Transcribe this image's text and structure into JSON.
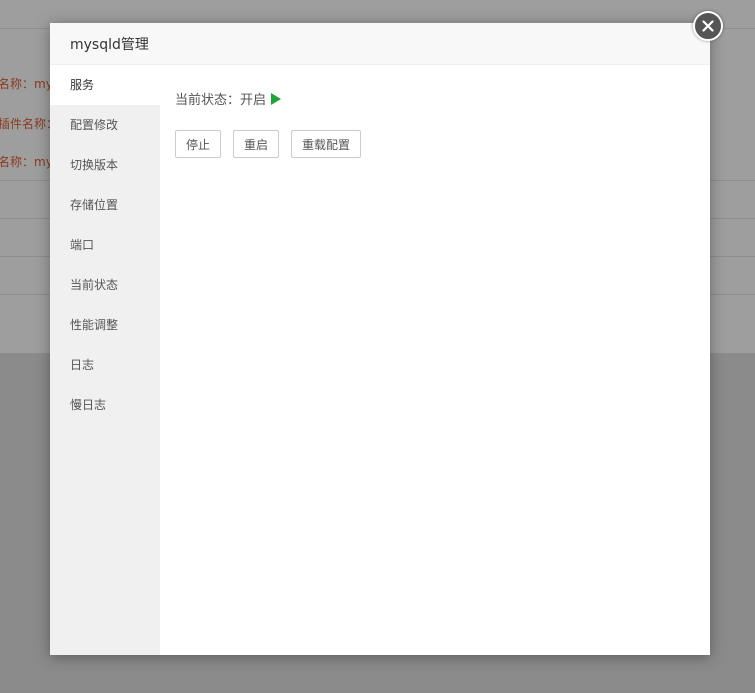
{
  "background": {
    "row_texts": [
      "名称：mys",
      "插件名称：",
      "名称：my"
    ]
  },
  "modal": {
    "title": "mysqld管理",
    "close_icon": "close-icon"
  },
  "sidebar": {
    "items": [
      {
        "label": "服务",
        "active": true
      },
      {
        "label": "配置修改"
      },
      {
        "label": "切换版本"
      },
      {
        "label": "存储位置"
      },
      {
        "label": "端口"
      },
      {
        "label": "当前状态"
      },
      {
        "label": "性能调整"
      },
      {
        "label": "日志"
      },
      {
        "label": "慢日志"
      }
    ]
  },
  "service": {
    "status_label": "当前状态：",
    "status_value": "开启",
    "status_icon": "play-icon",
    "status_color": "#20a53a",
    "buttons": {
      "stop": "停止",
      "restart": "重启",
      "reload": "重载配置"
    }
  }
}
